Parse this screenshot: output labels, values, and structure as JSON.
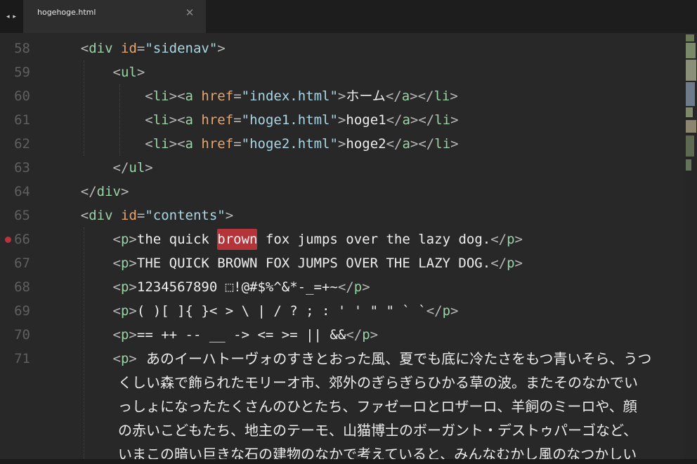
{
  "tabbar": {
    "nav_glyph": "◂ ▸",
    "tab_title": "hogehoge.html",
    "close_glyph": "✕"
  },
  "editor": {
    "line_numbers": [
      "58",
      "59",
      "60",
      "61",
      "62",
      "63",
      "64",
      "65",
      "66",
      "67",
      "68",
      "69",
      "70",
      "71"
    ],
    "breakpoint_line": "66",
    "highlight_word": "brown",
    "lines": {
      "l58": {
        "indent": "    ",
        "open": "<",
        "tag": "div",
        "attr": "id",
        "eq": "=",
        "val": "\"sidenav\"",
        "close": ">"
      },
      "l59": {
        "indent": "        ",
        "open": "<",
        "tag": "ul",
        "close": ">"
      },
      "l60": {
        "indent": "            ",
        "p1": "<",
        "tag1": "li",
        "p2": "><",
        "tag2": "a",
        "attr": "href",
        "eq": "=",
        "val": "\"index.html\"",
        "p3": ">",
        "text": "ホーム",
        "p4": "</",
        "tag3": "a",
        "p5": "></",
        "tag4": "li",
        "p6": ">"
      },
      "l61": {
        "indent": "            ",
        "p1": "<",
        "tag1": "li",
        "p2": "><",
        "tag2": "a",
        "attr": "href",
        "eq": "=",
        "val": "\"hoge1.html\"",
        "p3": ">",
        "text": "hoge1",
        "p4": "</",
        "tag3": "a",
        "p5": "></",
        "tag4": "li",
        "p6": ">"
      },
      "l62": {
        "indent": "            ",
        "p1": "<",
        "tag1": "li",
        "p2": "><",
        "tag2": "a",
        "attr": "href",
        "eq": "=",
        "val": "\"hoge2.html\"",
        "p3": ">",
        "text": "hoge2",
        "p4": "</",
        "tag3": "a",
        "p5": "></",
        "tag4": "li",
        "p6": ">"
      },
      "l63": {
        "indent": "        ",
        "open": "</",
        "tag": "ul",
        "close": ">"
      },
      "l64": {
        "indent": "    ",
        "open": "</",
        "tag": "div",
        "close": ">"
      },
      "l65": {
        "indent": "    ",
        "open": "<",
        "tag": "div",
        "attr": "id",
        "eq": "=",
        "val": "\"contents\"",
        "close": ">"
      },
      "l66": {
        "indent": "        ",
        "p1": "<",
        "tag1": "p",
        "p2": ">",
        "text_before": "the quick ",
        "text_after": " fox jumps over the lazy dog.",
        "p3": "</",
        "tag2": "p",
        "p4": ">"
      },
      "l67": {
        "indent": "        ",
        "p1": "<",
        "tag1": "p",
        "p2": ">",
        "text": "THE QUICK BROWN FOX JUMPS OVER THE LAZY DOG.",
        "p3": "</",
        "tag2": "p",
        "p4": ">"
      },
      "l68": {
        "indent": "        ",
        "p1": "<",
        "tag1": "p",
        "p2": ">",
        "text": "1234567890 ⬚!@#$%^&*-_=+~",
        "p3": "</",
        "tag2": "p",
        "p4": ">"
      },
      "l69": {
        "indent": "        ",
        "p1": "<",
        "tag1": "p",
        "p2": ">",
        "text": "( )[ ]{ }< > \\ | / ? ; : ' ' \" \" ` `",
        "p3": "</",
        "tag2": "p",
        "p4": ">"
      },
      "l70": {
        "indent": "        ",
        "p1": "<",
        "tag1": "p",
        "p2": ">",
        "text": "== ++ -- __ -> <= >= || &&",
        "p3": "</",
        "tag2": "p",
        "p4": ">"
      },
      "l71": {
        "indent": "        ",
        "p1": "<",
        "tag1": "p",
        "p2": ">"
      }
    },
    "japanese_paragraph": [
      "あのイーハトーヴォのすきとおった風、夏でも底に冷たさをもつ青いそら、うつ",
      "くしい森で飾られたモリーオ市、郊外のぎらぎらひかる草の波。またそのなかでい",
      "っしょになったたくさんのひとたち、ファゼーロとロザーロ、羊飼のミーロや、顔",
      "の赤いこどもたち、地主のテーモ、山猫博士のボーガント・デストゥパーゴなど、",
      "いまこの暗い巨きな石の建物のなかで考えていると、みんなむかし風のなつかしい"
    ]
  },
  "colors": {
    "background": "#282828",
    "tag": "#9ad3a6",
    "attribute": "#e7a56c",
    "string": "#a8d7e6",
    "highlight": "#b4343a",
    "line_number": "#5f5f5f"
  }
}
